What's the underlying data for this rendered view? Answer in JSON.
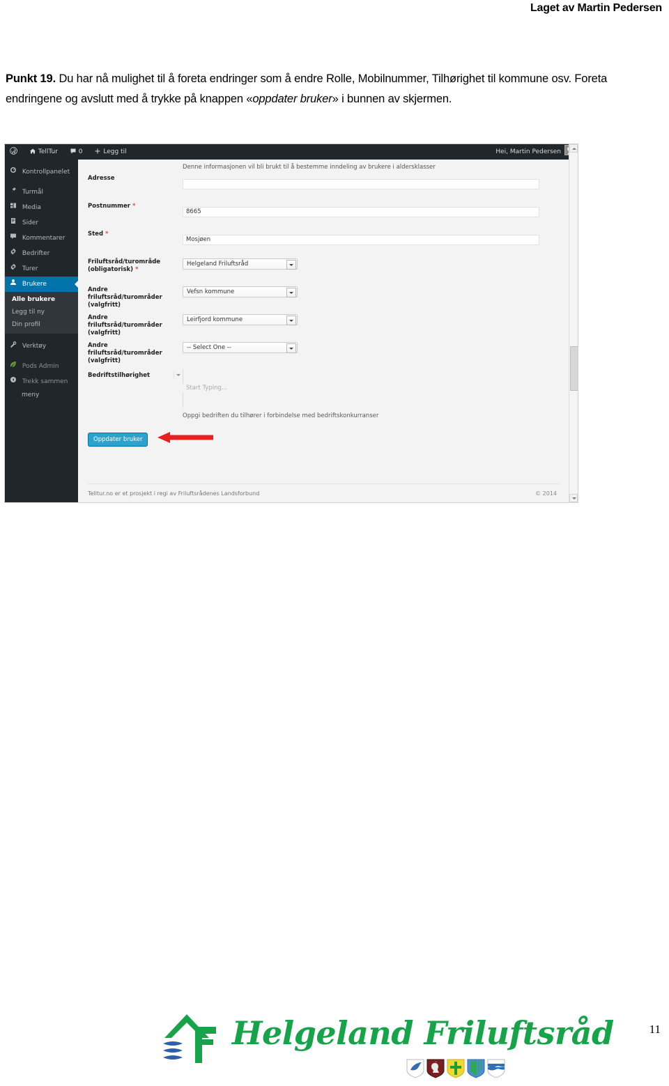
{
  "document": {
    "author_header": "Laget av Martin Pedersen",
    "page_number": "11",
    "instruction": {
      "lead": "Punkt 19.",
      "part1": " Du har nå mulighet til å foreta endringer som å endre Rolle, Mobilnummer, Tilhørighet til kommune osv.  Foreta endringene og avslutt med å trykke på knappen «",
      "emphasis": "oppdater bruker",
      "part2": "» i bunnen av skjermen."
    }
  },
  "screenshot": {
    "adminbar": {
      "wp_logo": "wordpress-logo-icon",
      "site_name": "TellTur",
      "comments_count": "0",
      "new_label": "Legg til",
      "greeting": "Hei, Martin Pedersen"
    },
    "sidebar": {
      "items": [
        {
          "label": "Kontrollpanelet",
          "icon": "dashboard-icon",
          "active": false
        },
        {
          "label": "Turmål",
          "icon": "pin-icon",
          "active": false
        },
        {
          "label": "Media",
          "icon": "media-icon",
          "active": false
        },
        {
          "label": "Sider",
          "icon": "pages-icon",
          "active": false
        },
        {
          "label": "Kommentarer",
          "icon": "comments-icon",
          "active": false
        },
        {
          "label": "Bedrifter",
          "icon": "gear-icon",
          "active": false
        },
        {
          "label": "Turer",
          "icon": "gear-icon",
          "active": false
        },
        {
          "label": "Brukere",
          "icon": "users-icon",
          "active": true
        }
      ],
      "submenu": [
        {
          "label": "Alle brukere",
          "current": true
        },
        {
          "label": "Legg til ny",
          "current": false
        },
        {
          "label": "Din profil",
          "current": false
        }
      ],
      "tools_label": "Verktøy",
      "pods_label": "Pods Admin",
      "collapse_label": "Trekk sammen",
      "collapse_label2": "meny"
    },
    "form": {
      "intro_note": "Denne informasjonen vil bli brukt til å bestemme inndeling av brukere i aldersklasser",
      "fields": [
        {
          "label": "Adresse",
          "required": false,
          "type": "text",
          "value": "",
          "placeholder": ""
        },
        {
          "label": "Postnummer",
          "required": true,
          "type": "text",
          "value": "8665",
          "placeholder": ""
        },
        {
          "label": "Sted",
          "required": true,
          "type": "text",
          "value": "Mosjøen",
          "placeholder": ""
        },
        {
          "label": "Friluftsråd/turområde",
          "label2": "(obligatorisk)",
          "required": true,
          "type": "select",
          "value": "Helgeland Friluftsråd"
        },
        {
          "label": "Andre friluftsråd/turområder",
          "label2": "(valgfritt)",
          "required": false,
          "type": "select",
          "value": "Vefsn kommune"
        },
        {
          "label": "Andre friluftsråd/turområder",
          "label2": "(valgfritt)",
          "required": false,
          "type": "select",
          "value": "Leirfjord kommune"
        },
        {
          "label": "Andre friluftsråd/turområder",
          "label2": "(valgfritt)",
          "required": false,
          "type": "select",
          "value": "-- Select One --"
        },
        {
          "label": "Bedriftstilhørighet",
          "required": false,
          "type": "autocomplete",
          "value": "",
          "placeholder": "Start Typing..."
        }
      ],
      "company_hint": "Oppgi bedriften du tilhører i forbindelse med bedriftskonkurranser",
      "submit_label": "Oppdater bruker"
    },
    "footer": {
      "note": "Telltur.no er et prosjekt i regi av Friluftsrådenes Landsforbund",
      "copyright": "© 2014"
    },
    "colors": {
      "admin_bg": "#23282d",
      "submenu_bg": "#32373c",
      "active_blue": "#0073aa",
      "button_blue": "#2ea2cc",
      "content_bg": "#f1f1f1",
      "required_red": "#e14d43",
      "arrow_red": "#e52322"
    }
  },
  "brand": {
    "logo_text": "Helgeland Friluftsråd",
    "logo_color": "#17a349",
    "shields": [
      {
        "name": "shield-dolphin",
        "bg": "#ffffff",
        "fg": "#2f6fb5"
      },
      {
        "name": "shield-rooster",
        "bg": "#7a1f1f",
        "fg": "#e9e9e9"
      },
      {
        "name": "shield-green-cross",
        "bg": "#f2d733",
        "fg": "#1f9b33"
      },
      {
        "name": "shield-green-stripes",
        "bg": "#4a8fd4",
        "fg": "#2faa4a"
      },
      {
        "name": "shield-blue-wave",
        "bg": "#ffffff",
        "fg": "#2f6fb5"
      }
    ]
  }
}
